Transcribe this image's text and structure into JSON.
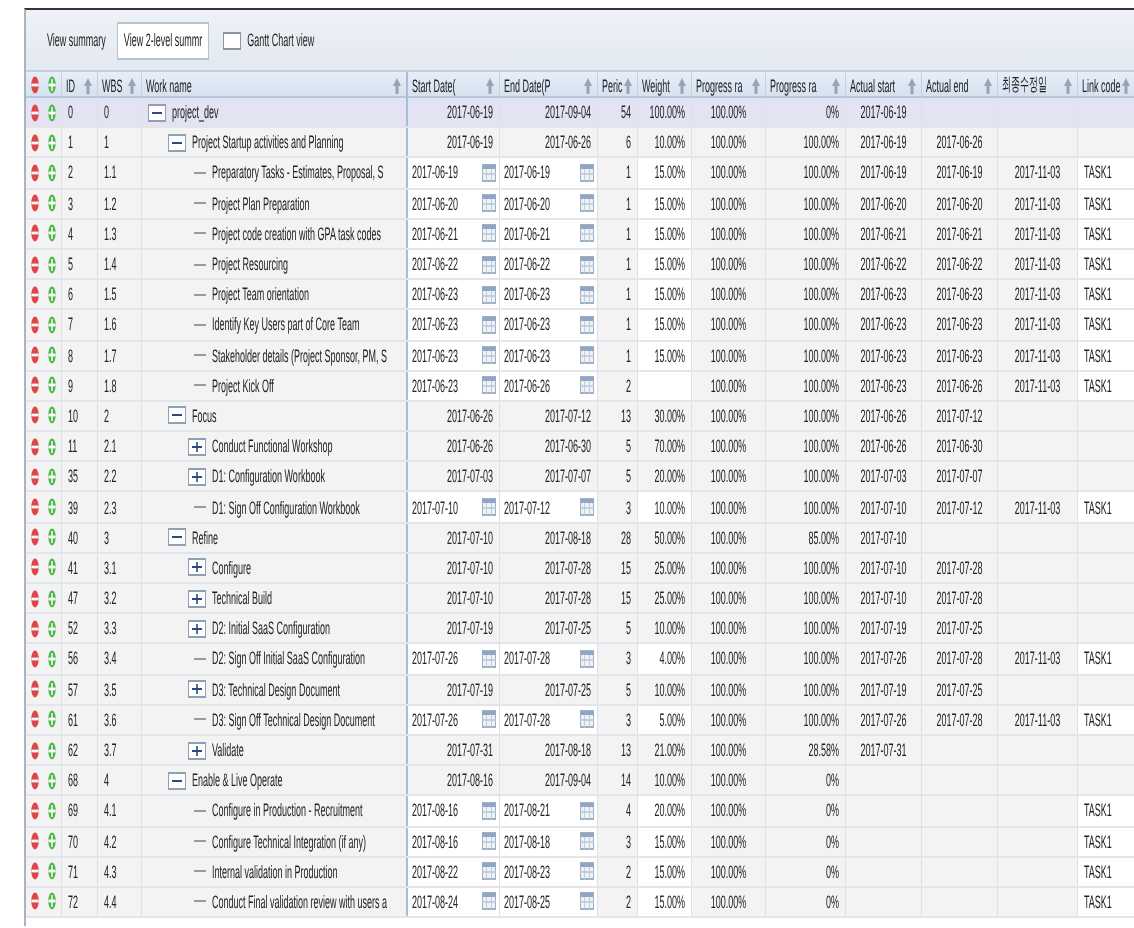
{
  "toolbar": {
    "tabs": [
      {
        "label": "View summary",
        "selected": false
      },
      {
        "label": "View 2-level summr",
        "selected": true
      }
    ],
    "gantt_checkbox": {
      "label": "Gantt Chart view",
      "checked": false
    }
  },
  "table": {
    "columns": [
      "ID",
      "WBS",
      "Work name",
      "Start Date(",
      "End Date(P",
      "Peric",
      "Weight",
      "Progress ra",
      "Progress ra",
      "Actual start",
      "Actual end",
      "최종수정일",
      "Link code"
    ],
    "rows": [
      {
        "id": "0",
        "wbs": "0",
        "name": "project_dev",
        "kind": "summary",
        "expanded": true,
        "selected": true,
        "start": "2017-06-19",
        "end": "2017-09-04",
        "period": "54",
        "weight": "100.00%",
        "progress_1": "100.00%",
        "progress_2": "0%",
        "actual_start": "2017-06-19",
        "children": [
          {
            "id": "1",
            "wbs": "1",
            "name": "Project Startup activities and Planning",
            "kind": "summary",
            "expanded": true,
            "selected": false,
            "start": "2017-06-19",
            "end": "2017-06-26",
            "period": "6",
            "weight": "10.00%",
            "progress_1": "100.00%",
            "progress_2": "100.00%",
            "actual_start": "2017-06-19",
            "actual_end": "2017-06-26",
            "children": [
              {
                "id": "2",
                "wbs": "1.1",
                "name": "Preparatory Tasks - Estimates, Proposal, S",
                "kind": "task",
                "selected": false,
                "start": "2017-06-19",
                "end": "2017-06-19",
                "period": "1",
                "weight": "15.00%",
                "progress_1": "100.00%",
                "progress_2": "100.00%",
                "actual_start": "2017-06-19",
                "actual_end": "2017-06-19",
                "modified": "2017-11-03",
                "link_code": "TASK1"
              },
              {
                "id": "3",
                "wbs": "1.2",
                "name": "Project Plan Preparation",
                "kind": "task",
                "selected": false,
                "start": "2017-06-20",
                "end": "2017-06-20",
                "period": "1",
                "weight": "15.00%",
                "progress_1": "100.00%",
                "progress_2": "100.00%",
                "actual_start": "2017-06-20",
                "actual_end": "2017-06-20",
                "modified": "2017-11-03",
                "link_code": "TASK1"
              },
              {
                "id": "4",
                "wbs": "1.3",
                "name": "Project code creation with GPA task codes",
                "kind": "task",
                "selected": false,
                "start": "2017-06-21",
                "end": "2017-06-21",
                "period": "1",
                "weight": "15.00%",
                "progress_1": "100.00%",
                "progress_2": "100.00%",
                "actual_start": "2017-06-21",
                "actual_end": "2017-06-21",
                "modified": "2017-11-03",
                "link_code": "TASK1"
              },
              {
                "id": "5",
                "wbs": "1.4",
                "name": "Project Resourcing",
                "kind": "task",
                "selected": false,
                "start": "2017-06-22",
                "end": "2017-06-22",
                "period": "1",
                "weight": "15.00%",
                "progress_1": "100.00%",
                "progress_2": "100.00%",
                "actual_start": "2017-06-22",
                "actual_end": "2017-06-22",
                "modified": "2017-11-03",
                "link_code": "TASK1"
              },
              {
                "id": "6",
                "wbs": "1.5",
                "name": "Project Team orientation",
                "kind": "task",
                "selected": false,
                "start": "2017-06-23",
                "end": "2017-06-23",
                "period": "1",
                "weight": "15.00%",
                "progress_1": "100.00%",
                "progress_2": "100.00%",
                "actual_start": "2017-06-23",
                "actual_end": "2017-06-23",
                "modified": "2017-11-03",
                "link_code": "TASK1"
              },
              {
                "id": "7",
                "wbs": "1.6",
                "name": "Identify Key Users part of Core Team",
                "kind": "task",
                "selected": false,
                "start": "2017-06-23",
                "end": "2017-06-23",
                "period": "1",
                "weight": "15.00%",
                "progress_1": "100.00%",
                "progress_2": "100.00%",
                "actual_start": "2017-06-23",
                "actual_end": "2017-06-23",
                "modified": "2017-11-03",
                "link_code": "TASK1"
              },
              {
                "id": "8",
                "wbs": "1.7",
                "name": "Stakeholder details (Project Sponsor, PM, S",
                "kind": "task",
                "selected": false,
                "start": "2017-06-23",
                "end": "2017-06-23",
                "period": "1",
                "weight": "15.00%",
                "progress_1": "100.00%",
                "progress_2": "100.00%",
                "actual_start": "2017-06-23",
                "actual_end": "2017-06-23",
                "modified": "2017-11-03",
                "link_code": "TASK1"
              },
              {
                "id": "9",
                "wbs": "1.8",
                "name": "Project Kick Off",
                "kind": "task",
                "selected": false,
                "start": "2017-06-23",
                "end": "2017-06-26",
                "period": "2",
                "progress_1": "100.00%",
                "progress_2": "100.00%",
                "actual_start": "2017-06-23",
                "actual_end": "2017-06-26",
                "modified": "2017-11-03",
                "link_code": "TASK1"
              }
            ]
          },
          {
            "id": "10",
            "wbs": "2",
            "name": "Focus",
            "kind": "summary",
            "expanded": true,
            "selected": false,
            "start": "2017-06-26",
            "end": "2017-07-12",
            "period": "13",
            "weight": "30.00%",
            "progress_1": "100.00%",
            "progress_2": "100.00%",
            "actual_start": "2017-06-26",
            "actual_end": "2017-07-12",
            "children": [
              {
                "id": "11",
                "wbs": "2.1",
                "name": "Conduct Functional Workshop",
                "kind": "summary",
                "expanded": false,
                "selected": false,
                "start": "2017-06-26",
                "end": "2017-06-30",
                "period": "5",
                "weight": "70.00%",
                "progress_1": "100.00%",
                "progress_2": "100.00%",
                "actual_start": "2017-06-26",
                "actual_end": "2017-06-30"
              },
              {
                "id": "35",
                "wbs": "2.2",
                "name": "D1: Configuration Workbook",
                "kind": "summary",
                "expanded": false,
                "selected": false,
                "start": "2017-07-03",
                "end": "2017-07-07",
                "period": "5",
                "weight": "20.00%",
                "progress_1": "100.00%",
                "progress_2": "100.00%",
                "actual_start": "2017-07-03",
                "actual_end": "2017-07-07"
              },
              {
                "id": "39",
                "wbs": "2.3",
                "name": "D1: Sign Off Configuration Workbook",
                "kind": "task",
                "selected": false,
                "start": "2017-07-10",
                "end": "2017-07-12",
                "period": "3",
                "weight": "10.00%",
                "progress_1": "100.00%",
                "progress_2": "100.00%",
                "actual_start": "2017-07-10",
                "actual_end": "2017-07-12",
                "modified": "2017-11-03",
                "link_code": "TASK1"
              }
            ]
          },
          {
            "id": "40",
            "wbs": "3",
            "name": "Refine",
            "kind": "summary",
            "expanded": true,
            "selected": false,
            "start": "2017-07-10",
            "end": "2017-08-18",
            "period": "28",
            "weight": "50.00%",
            "progress_1": "100.00%",
            "progress_2": "85.00%",
            "actual_start": "2017-07-10",
            "children": [
              {
                "id": "41",
                "wbs": "3.1",
                "name": "Configure",
                "kind": "summary",
                "expanded": false,
                "selected": false,
                "start": "2017-07-10",
                "end": "2017-07-28",
                "period": "15",
                "weight": "25.00%",
                "progress_1": "100.00%",
                "progress_2": "100.00%",
                "actual_start": "2017-07-10",
                "actual_end": "2017-07-28"
              },
              {
                "id": "47",
                "wbs": "3.2",
                "name": "Technical Build",
                "kind": "summary",
                "expanded": false,
                "selected": false,
                "start": "2017-07-10",
                "end": "2017-07-28",
                "period": "15",
                "weight": "25.00%",
                "progress_1": "100.00%",
                "progress_2": "100.00%",
                "actual_start": "2017-07-10",
                "actual_end": "2017-07-28"
              },
              {
                "id": "52",
                "wbs": "3.3",
                "name": "D2: Initial SaaS Configuration",
                "kind": "summary",
                "expanded": false,
                "selected": false,
                "start": "2017-07-19",
                "end": "2017-07-25",
                "period": "5",
                "weight": "10.00%",
                "progress_1": "100.00%",
                "progress_2": "100.00%",
                "actual_start": "2017-07-19",
                "actual_end": "2017-07-25"
              },
              {
                "id": "56",
                "wbs": "3.4",
                "name": "D2: Sign Off Initial SaaS Configuration",
                "kind": "task",
                "selected": false,
                "start": "2017-07-26",
                "end": "2017-07-28",
                "period": "3",
                "weight": "4.00%",
                "progress_1": "100.00%",
                "progress_2": "100.00%",
                "actual_start": "2017-07-26",
                "actual_end": "2017-07-28",
                "modified": "2017-11-03",
                "link_code": "TASK1"
              },
              {
                "id": "57",
                "wbs": "3.5",
                "name": "D3: Technical Design Document",
                "kind": "summary",
                "expanded": false,
                "selected": false,
                "start": "2017-07-19",
                "end": "2017-07-25",
                "period": "5",
                "weight": "10.00%",
                "progress_1": "100.00%",
                "progress_2": "100.00%",
                "actual_start": "2017-07-19",
                "actual_end": "2017-07-25"
              },
              {
                "id": "61",
                "wbs": "3.6",
                "name": "D3: Sign Off Technical Design Document",
                "kind": "task",
                "selected": false,
                "start": "2017-07-26",
                "end": "2017-07-28",
                "period": "3",
                "weight": "5.00%",
                "progress_1": "100.00%",
                "progress_2": "100.00%",
                "actual_start": "2017-07-26",
                "actual_end": "2017-07-28",
                "modified": "2017-11-03",
                "link_code": "TASK1"
              },
              {
                "id": "62",
                "wbs": "3.7",
                "name": "Validate",
                "kind": "summary",
                "expanded": false,
                "selected": false,
                "start": "2017-07-31",
                "end": "2017-08-18",
                "period": "13",
                "weight": "21.00%",
                "progress_1": "100.00%",
                "progress_2": "28.58%",
                "actual_start": "2017-07-31"
              }
            ]
          },
          {
            "id": "68",
            "wbs": "4",
            "name": "Enable & Live Operate",
            "kind": "summary",
            "expanded": true,
            "selected": false,
            "start": "2017-08-16",
            "end": "2017-09-04",
            "period": "14",
            "weight": "10.00%",
            "progress_1": "100.00%",
            "progress_2": "0%",
            "children": [
              {
                "id": "69",
                "wbs": "4.1",
                "name": "Configure in Production - Recruitment",
                "kind": "task",
                "selected": false,
                "start": "2017-08-16",
                "end": "2017-08-21",
                "period": "4",
                "weight": "20.00%",
                "progress_1": "100.00%",
                "progress_2": "0%",
                "link_code": "TASK1"
              },
              {
                "id": "70",
                "wbs": "4.2",
                "name": "Configure Technical Integration (if any)",
                "kind": "task",
                "selected": false,
                "start": "2017-08-16",
                "end": "2017-08-18",
                "period": "3",
                "weight": "15.00%",
                "progress_1": "100.00%",
                "progress_2": "0%",
                "link_code": "TASK1"
              },
              {
                "id": "71",
                "wbs": "4.3",
                "name": "Internal validation in Production",
                "kind": "task",
                "selected": false,
                "start": "2017-08-22",
                "end": "2017-08-23",
                "period": "2",
                "weight": "15.00%",
                "progress_1": "100.00%",
                "progress_2": "0%",
                "link_code": "TASK1"
              },
              {
                "id": "72",
                "wbs": "4.4",
                "name": "Conduct Final validation review with users a",
                "kind": "task",
                "selected": false,
                "start": "2017-08-24",
                "end": "2017-08-25",
                "period": "2",
                "weight": "15.00%",
                "progress_1": "100.00%",
                "progress_2": "0%",
                "link_code": "TASK1"
              }
            ]
          }
        ]
      }
    ]
  }
}
